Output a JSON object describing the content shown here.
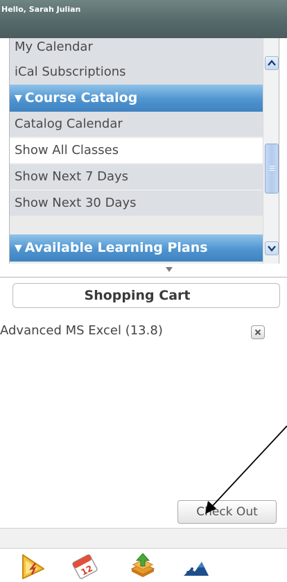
{
  "header": {
    "greeting": "Hello, Sarah Julian"
  },
  "nav": {
    "items": [
      {
        "label": "My Calendar"
      },
      {
        "label": "iCal Subscriptions"
      },
      {
        "label": "Course Catalog",
        "arrow": "▼"
      },
      {
        "label": "Catalog Calendar"
      },
      {
        "label": "Show All Classes",
        "selected": true
      },
      {
        "label": "Show Next 7 Days"
      },
      {
        "label": "Show Next 30 Days"
      },
      {
        "label": "Available Learning Plans",
        "arrow": "▼"
      }
    ]
  },
  "splitter": {
    "icon": "triangle-down-icon"
  },
  "cart": {
    "title": "Shopping Cart",
    "items": [
      {
        "name": "Advanced MS Excel (13.8)",
        "remove_icon": "close-icon"
      }
    ],
    "checkout_label": "Check Out"
  },
  "toolbar": {
    "icons": [
      "alert-icon",
      "calendar-icon",
      "course-catalog-icon",
      "learning-plans-icon"
    ]
  },
  "colors": {
    "header_bg": "#56696b",
    "section_header_bg": "#4f95d0",
    "nav_item_bg": "#dcdfe4",
    "selected_item_bg": "#ffffff"
  }
}
